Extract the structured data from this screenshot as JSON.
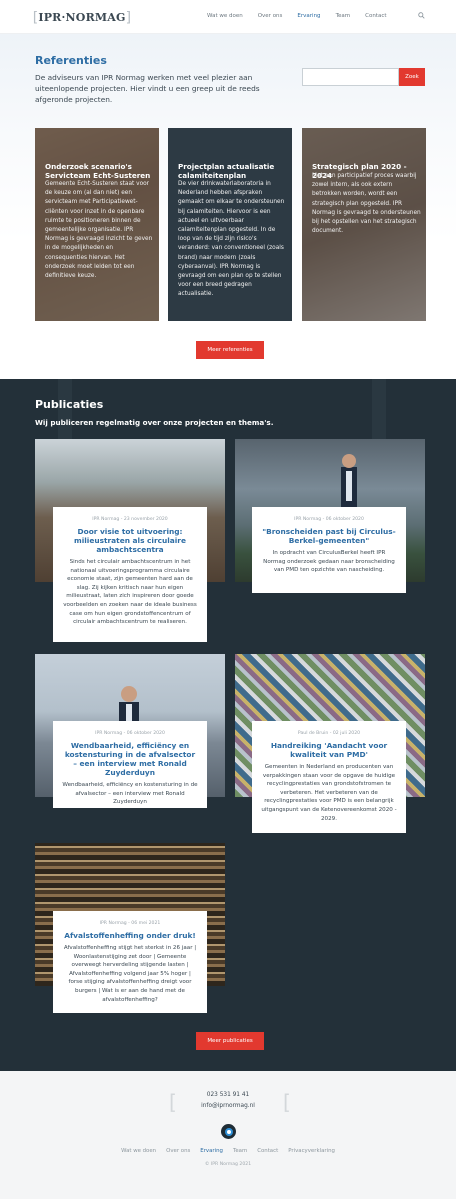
{
  "header": {
    "logo_text": "IPR·NORMAG",
    "nav": [
      {
        "label": "Wat we doen",
        "active": false
      },
      {
        "label": "Over ons",
        "active": false
      },
      {
        "label": "Ervaring",
        "active": true
      },
      {
        "label": "Team",
        "active": false
      },
      {
        "label": "Contact",
        "active": false
      }
    ],
    "search_icon": "search-icon"
  },
  "referenties": {
    "title": "Referenties",
    "intro": "De adviseurs van IPR Normag werken met veel plezier aan uiteenlopende projecten. Hier vindt u een greep uit de reeds afgeronde projecten.",
    "search_placeholder": "",
    "search_button": "Zoek",
    "cards": [
      {
        "title": "Onderzoek scenario's Servicteam Echt-Susteren",
        "text": "Gemeente Echt-Susteren staat voor de keuze om (al dan niet) een servicteam met Participatiewet-cliënten voor inzet in de openbare ruimte te positioneren binnen de gemeentelijke organisatie. IPR Normag is gevraagd inzicht te geven in de mogelijkheden en consequenties hiervan. Het onderzoek moet leiden tot een definitieve keuze."
      },
      {
        "title": "Projectplan actualisatie calamiteitenplan",
        "text": "De vier drinkwaterlaboratoria in Nederland hebben afspraken gemaakt om elkaar te ondersteunen bij calamiteiten. Hiervoor is een actueel en uitvoerbaar calamiteitenplan opgesteld. In de loop van de tijd zijn risico's veranderd: van conventioneel (zoals brand) naar modern (zoals cyberaanval). IPR Normag is gevraagd om een plan op te stellen voor een breed gedragen actualisatie."
      },
      {
        "title": "Strategisch plan 2020 - 2024",
        "text": "Met een participatief proces waarbij zowel intern, als ook extern betrokken worden, wordt een strategisch plan opgesteld. IPR Normag is gevraagd te ondersteunen bij het opstellen van het strategisch document."
      }
    ],
    "more_button": "Meer referenties"
  },
  "publicaties": {
    "title": "Publicaties",
    "subtitle": "Wij publiceren regelmatig over onze projecten en thema's.",
    "items": [
      {
        "meta": "IPR Normag - 23 november 2020",
        "title": "Door visie tot uitvoering: milieustraten als circulaire ambachtscentra",
        "text": "Sinds het circulair ambachtscentrum in het nationaal uitvoeringsprogramma circulaire economie staat, zijn gemeenten hard aan de slag. Zij kijken kritisch naar hun eigen milieustraat, laten zich inspireren door goede voorbeelden en zoeken naar de ideale business case om hun eigen grondstoffencentrum of circulair ambachtscentrum te realiseren."
      },
      {
        "meta": "IPR Normag - 06 oktober 2020",
        "title": "\"Bronscheiden past bij Circulus-Berkel-gemeenten\"",
        "text": "In opdracht van CirculusBerkel heeft IPR Normag onderzoek gedaan naar bronscheiding van PMD ten opzichte van nascheiding."
      },
      {
        "meta": "IPR Normag - 06 oktober 2020",
        "title": "Wendbaarheid, efficiëncy en kostensturing in de afvalsector – een interview met Ronald Zuyderduyn",
        "text": "Wendbaarheid, efficiëncy en kostensturing in de afvalsector – een interview met Ronald Zuyderduyn"
      },
      {
        "meta": "Paul de Bruin - 02 juli 2020",
        "title": "Handreiking 'Aandacht voor kwaliteit van PMD'",
        "text": "Gemeenten in Nederland en producenten van verpakkingen staan voor de opgave de huidige recyclingprestaties van grondstofstromen te verbeteren. Het verbeteren van de recyclingprestaties voor PMD is een belangrijk uitgangspunt van de Ketenovereenkomst 2020 - 2029."
      },
      {
        "meta": "IPR Normag - 06 mei 2021",
        "title": "Afvalstoffenheffing onder druk!",
        "text": "Afvalstoffenheffing stijgt het sterkst in 26 jaar | Woonlastenstijging zet door | Gemeente overweegt herverdeling stijgende lasten | Afvalstoffenheffing volgend jaar 5% hoger | forse stijging afvalstoffenheffing dreigt voor burgers | Wat is er aan de hand met de afvalstoffenheffing?"
      }
    ],
    "more_button": "Meer publicaties"
  },
  "footer": {
    "phone": "023 531 91 41",
    "email": "info@iprnormag.nl",
    "nav": [
      {
        "label": "Wat we doen",
        "active": false
      },
      {
        "label": "Over ons",
        "active": false
      },
      {
        "label": "Ervaring",
        "active": true
      },
      {
        "label": "Team",
        "active": false
      },
      {
        "label": "Contact",
        "active": false
      },
      {
        "label": "Privacyverklaring",
        "active": false
      }
    ],
    "copyright": "© IPR Normag 2021"
  },
  "colors": {
    "accent": "#e2392f",
    "link": "#2e6da4",
    "dark": "#233039"
  }
}
